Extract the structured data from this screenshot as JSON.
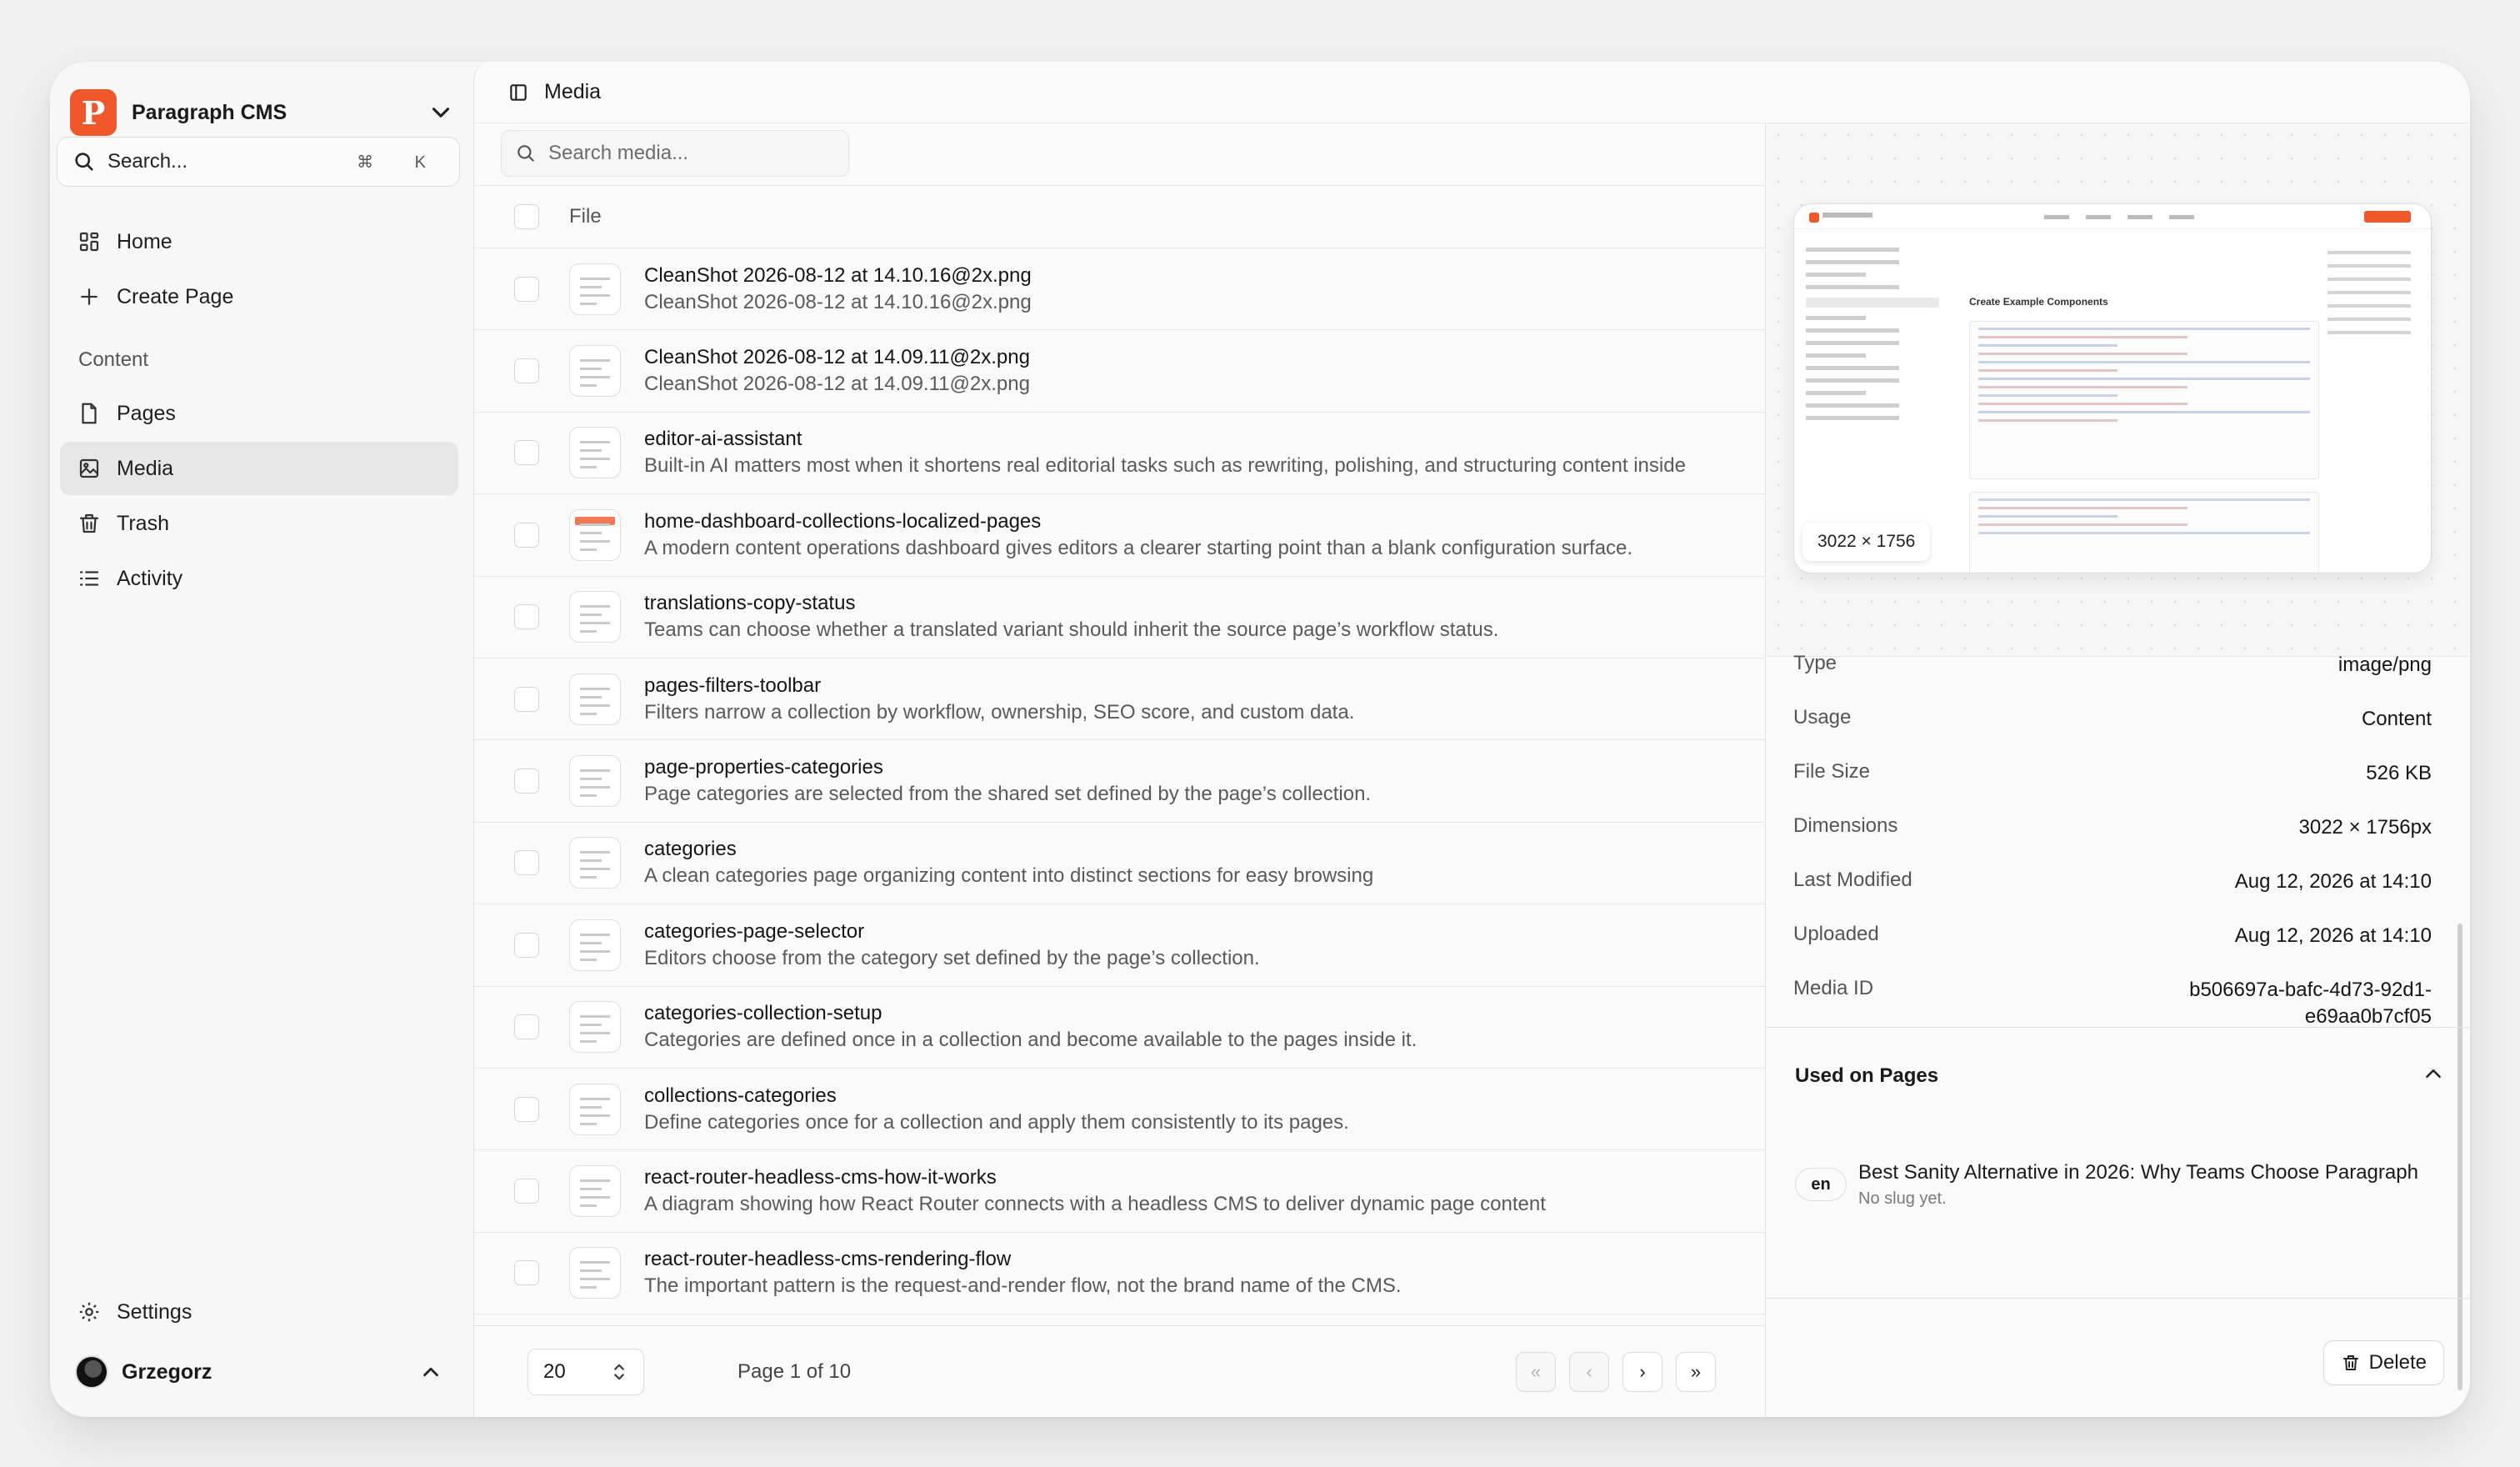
{
  "app": {
    "name": "Paragraph CMS",
    "logo_letter": "P",
    "accent": "#f0572b"
  },
  "sidebar": {
    "search_label": "Search...",
    "search_shortcut": "⌘ K",
    "nav_top": [
      {
        "label": "Home",
        "icon": "home-grid-icon"
      },
      {
        "label": "Create Page",
        "icon": "plus-icon"
      }
    ],
    "section_label": "Content",
    "nav_content": [
      {
        "label": "Pages",
        "icon": "file-icon",
        "active": false
      },
      {
        "label": "Media",
        "icon": "image-icon",
        "active": true
      },
      {
        "label": "Trash",
        "icon": "trash-icon",
        "active": false
      },
      {
        "label": "Activity",
        "icon": "list-icon",
        "active": false
      }
    ],
    "settings_label": "Settings",
    "user_name": "Grzegorz"
  },
  "header": {
    "title": "Media"
  },
  "media": {
    "search_placeholder": "Search media...",
    "column_file": "File",
    "rows": [
      {
        "title": "CleanShot 2026-08-12 at 14.10.16@2x.png",
        "desc": "CleanShot 2026-08-12 at 14.10.16@2x.png"
      },
      {
        "title": "CleanShot 2026-08-12 at 14.09.11@2x.png",
        "desc": "CleanShot 2026-08-12 at 14.09.11@2x.png"
      },
      {
        "title": "editor-ai-assistant",
        "desc": "Built-in AI matters most when it shortens real editorial tasks such as rewriting, polishing, and structuring content inside"
      },
      {
        "title": "home-dashboard-collections-localized-pages",
        "desc": "A modern content operations dashboard gives editors a clearer starting point than a blank configuration surface."
      },
      {
        "title": "translations-copy-status",
        "desc": "Teams can choose whether a translated variant should inherit the source page’s workflow status."
      },
      {
        "title": "pages-filters-toolbar",
        "desc": "Filters narrow a collection by workflow, ownership, SEO score, and custom data."
      },
      {
        "title": "page-properties-categories",
        "desc": "Page categories are selected from the shared set defined by the page’s collection."
      },
      {
        "title": "categories",
        "desc": "A clean categories page organizing content into distinct sections for easy browsing"
      },
      {
        "title": "categories-page-selector",
        "desc": "Editors choose from the category set defined by the page’s collection."
      },
      {
        "title": "categories-collection-setup",
        "desc": "Categories are defined once in a collection and become available to the pages inside it."
      },
      {
        "title": "collections-categories",
        "desc": "Define categories once for a collection and apply them consistently to its pages."
      },
      {
        "title": "react-router-headless-cms-how-it-works",
        "desc": "A diagram showing how React Router connects with a headless CMS to deliver dynamic page content"
      },
      {
        "title": "react-router-headless-cms-rendering-flow",
        "desc": "The important pattern is the request-and-render flow, not the brand name of the CMS."
      }
    ],
    "per_page": "20",
    "page_info": "Page 1 of 10",
    "pager": {
      "first": "«",
      "prev": "‹",
      "next": "›",
      "last": "»"
    }
  },
  "detail": {
    "preview_dimensions": "3022 × 1756",
    "preview_heading": "Create Example Components",
    "properties": [
      {
        "key": "Type",
        "value": "image/png"
      },
      {
        "key": "Usage",
        "value": "Content"
      },
      {
        "key": "File Size",
        "value": "526 KB"
      },
      {
        "key": "Dimensions",
        "value": "3022 × 1756px"
      },
      {
        "key": "Last Modified",
        "value": "Aug 12, 2026 at 14:10"
      },
      {
        "key": "Uploaded",
        "value": "Aug 12, 2026 at 14:10"
      },
      {
        "key": "Media ID",
        "value": "b506697a-bafc-4d73-92d1-e69aa0b7cf05"
      }
    ],
    "used_on_pages_label": "Used on Pages",
    "used_pages": [
      {
        "lang": "en",
        "title": "Best Sanity Alternative in 2026: Why Teams Choose Paragraph",
        "slug": "No slug yet."
      }
    ],
    "delete_label": "Delete"
  }
}
